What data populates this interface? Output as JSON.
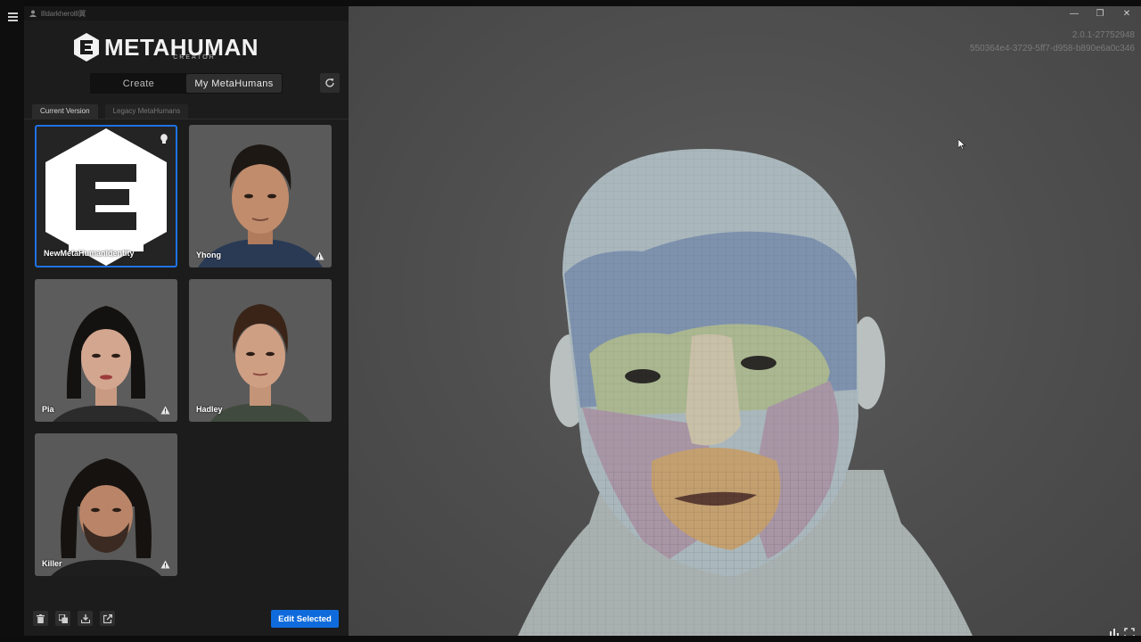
{
  "window": {
    "username": "llldarkherolll翼",
    "controls": {
      "minimize": "—",
      "restore": "❐",
      "close": "✕"
    }
  },
  "app": {
    "logo_text": "METAHUMAN",
    "logo_sub": "CREATOR",
    "version_line1": "2.0.1-27752948",
    "version_line2": "550364e4-3729-5ff7-d958-b890e6a0c346"
  },
  "mode_switch": {
    "create": "Create",
    "my_metahumans": "My MetaHumans",
    "active": "my_metahumans"
  },
  "tabs": {
    "current": "Current Version",
    "legacy": "Legacy MetaHumans",
    "active": "current"
  },
  "characters": [
    {
      "name": "NewMetaHumanIdentity",
      "selected": true,
      "warning": false,
      "badge": "mesh-identity-icon"
    },
    {
      "name": "Yhong",
      "selected": false,
      "warning": true
    },
    {
      "name": "Pia",
      "selected": false,
      "warning": true
    },
    {
      "name": "Hadley",
      "selected": false,
      "warning": false
    },
    {
      "name": "Killer",
      "selected": false,
      "warning": true
    }
  ],
  "bottom_bar": {
    "tools": [
      "trash-icon",
      "duplicate-icon",
      "download-icon",
      "export-icon"
    ],
    "edit_selected": "Edit Selected"
  },
  "colors": {
    "accent": "#1e72e6",
    "button_primary": "#0f6bdb",
    "panel": "#1c1c1c",
    "viewport": "#4f4f4f"
  }
}
